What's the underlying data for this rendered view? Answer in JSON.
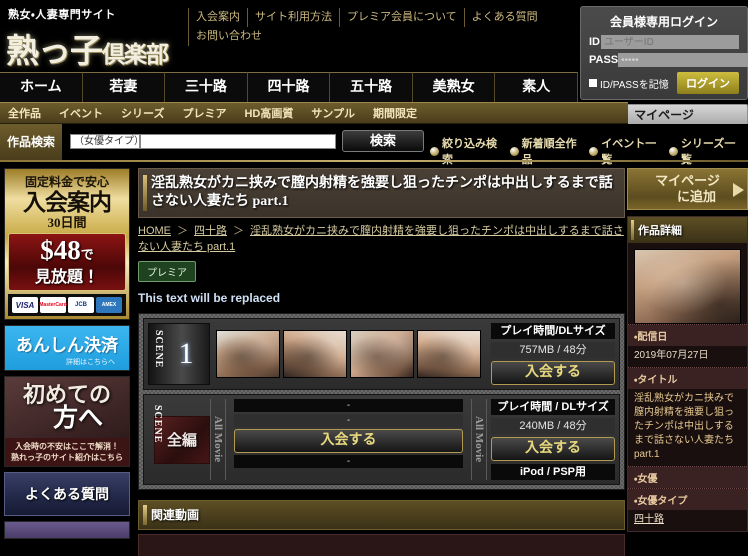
{
  "header": {
    "tagline": "熟女・人妻専門サイト",
    "logo_main": "熟っ子",
    "logo_sub": "倶楽部",
    "util_links": [
      "入会案内",
      "サイト利用方法",
      "プレミア会員について",
      "よくある質問",
      "お問い合わせ"
    ],
    "login": {
      "title": "会員様専用ログイン",
      "id_label": "ID",
      "id_placeholder": "ユーザーID",
      "pass_label": "PASS",
      "pass_value": "•••••",
      "remember_label": "ID/PASSを記憶",
      "login_button": "ログイン"
    },
    "mypage_button": "マイページ"
  },
  "nav": {
    "tabs": [
      "ホーム",
      "若妻",
      "三十路",
      "四十路",
      "五十路",
      "美熟女",
      "素人"
    ],
    "subnav": [
      "全作品",
      "イベント",
      "シリーズ",
      "プレミア",
      "HD高画質",
      "サンプル",
      "期間限定"
    ]
  },
  "search": {
    "label": "作品検索",
    "actress_type_selected": "（女優タイプ）",
    "keyword_value": "",
    "keyword_placeholder": "",
    "button": "検索",
    "quick_links": [
      "絞り込み検索",
      "新着順全作品",
      "イベント一覧",
      "シリーズ一覧"
    ]
  },
  "sidebar_left": {
    "join_banner": {
      "line1": "固定料金で安心",
      "line2": "入会案内",
      "line3": "30日間",
      "price": "$48",
      "price_suffix": "で",
      "price_line2": "見放題！",
      "cards": [
        "VISA",
        "MasterCard",
        "JCB",
        "AMEX"
      ]
    },
    "anshin_banner": {
      "title": "あんしん決済",
      "sub": "詳細はこちらへ"
    },
    "hajimete_banner": {
      "line1": "初めての",
      "line2": "方へ",
      "foot1": "入会時の不安はここで解消！",
      "foot2": "熟れっ子のサイト紹介はこちら"
    },
    "faq_banner": "よくある質問"
  },
  "main": {
    "title": "淫乱熟女がカニ挟みで膣内射精を強要し狙ったチンポは中出しするまで話さない人妻たち part.1",
    "breadcrumb": {
      "home": "HOME",
      "category": "四十路",
      "current": "淫乱熟女がカニ挟みで膣内射精を強要し狙ったチンポは中出しするまで話さない人妻たち part.1",
      "separator": "＞"
    },
    "badge": "プレミア",
    "player_placeholder": "This text will be replaced",
    "scenes": [
      {
        "label_vertical": "SCENE",
        "number": "1",
        "meta_head": "プレイ時間/DLサイズ",
        "meta_value": "757MB / 48分",
        "join_button": "入会する",
        "thumb_count": 4
      },
      {
        "label_vertical": "SCENE",
        "number": "全編",
        "all_movie_label": "All Movie",
        "dashes": [
          "-",
          "-",
          "-"
        ],
        "left_join_button": "入会する",
        "meta_head": "プレイ時間 / DLサイズ",
        "meta_value": "240MB / 48分",
        "join_button": "入会する",
        "ipod_label": "iPod / PSP用"
      }
    ],
    "related_header": "関連動画"
  },
  "sidebar_right": {
    "add_mypage": {
      "line1": "マイページ",
      "line2": "に追加"
    },
    "detail_header": "作品詳細",
    "details": [
      {
        "key": "配信日",
        "value": "2019年07月27日",
        "link": false
      },
      {
        "key": "タイトル",
        "value": "淫乱熟女がカニ挟みで膣内射精を強要し狙ったチンポは中出しするまで話さない人妻たち part.1",
        "link": false
      },
      {
        "key": "女優",
        "value": "",
        "link": false
      },
      {
        "key": "女優タイプ",
        "value": "四十路",
        "link": true
      }
    ]
  },
  "colors": {
    "gold": "#c8b271",
    "dark_gold": "#6d5c2c",
    "accent_red": "#8d1414",
    "bg": "#000000"
  }
}
